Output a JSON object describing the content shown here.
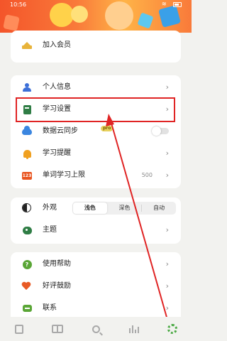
{
  "status_bar": {
    "time": "10:56"
  },
  "colors": {
    "accent_green": "#4caa45",
    "highlight_red": "#e02424",
    "banner_orange": "#f4552a"
  },
  "vip": {
    "label": "加入会员",
    "icon": "crown-icon"
  },
  "settings": {
    "items": [
      {
        "label": "个人信息",
        "icon": "person-icon"
      },
      {
        "label": "学习设置",
        "icon": "book-icon"
      },
      {
        "label": "数据云同步",
        "icon": "cloud-icon",
        "tag": "pro",
        "toggle": false
      },
      {
        "label": "学习提醒",
        "icon": "bell-icon"
      },
      {
        "label": "单词学习上限",
        "icon": "counter-icon",
        "badge": "123",
        "value": "500"
      }
    ]
  },
  "appearance": {
    "label": "外观",
    "icon": "contrast-icon",
    "options": [
      "浅色",
      "深色",
      "自动"
    ],
    "selected": "浅色"
  },
  "theme": {
    "label": "主题",
    "icon": "palette-icon"
  },
  "help": {
    "items": [
      {
        "label": "使用帮助",
        "icon": "question-icon"
      },
      {
        "label": "好评鼓励",
        "icon": "heart-icon"
      },
      {
        "label": "联系",
        "icon": "chat-icon"
      }
    ]
  },
  "chevron": "›",
  "bottom_nav": {
    "items": [
      "book-icon",
      "open-book-icon",
      "search-icon",
      "stats-icon",
      "settings-gear-icon"
    ],
    "active": "settings-gear-icon"
  }
}
